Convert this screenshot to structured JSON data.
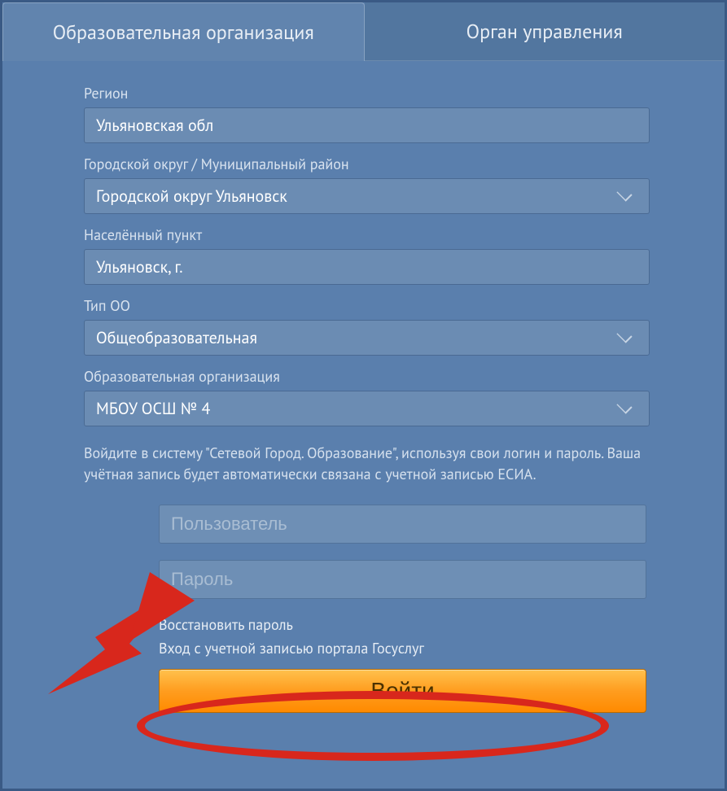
{
  "tabs": {
    "org": "Образовательная организация",
    "gov": "Орган управления"
  },
  "fields": {
    "region": {
      "label": "Регион",
      "value": "Ульяновская обл"
    },
    "district": {
      "label": "Городской округ / Муниципальный район",
      "value": "Городской округ Ульяновск"
    },
    "locality": {
      "label": "Населённый пункт",
      "value": "Ульяновск, г."
    },
    "ootype": {
      "label": "Тип ОО",
      "value": "Общеобразовательная"
    },
    "org": {
      "label": "Образовательная организация",
      "value": "МБОУ ОСШ № 4"
    }
  },
  "info": "Войдите в систему \"Сетевой Город. Образование\", используя свои логин и пароль. Ваша учётная запись будет автоматически связана с учетной записью ЕСИА.",
  "inputs": {
    "user_placeholder": "Пользователь",
    "pass_placeholder": "Пароль"
  },
  "links": {
    "recover": "Восстановить пароль",
    "gosuslugi": "Вход с учетной записью портала Госуслуг"
  },
  "buttons": {
    "login": "Войти"
  }
}
